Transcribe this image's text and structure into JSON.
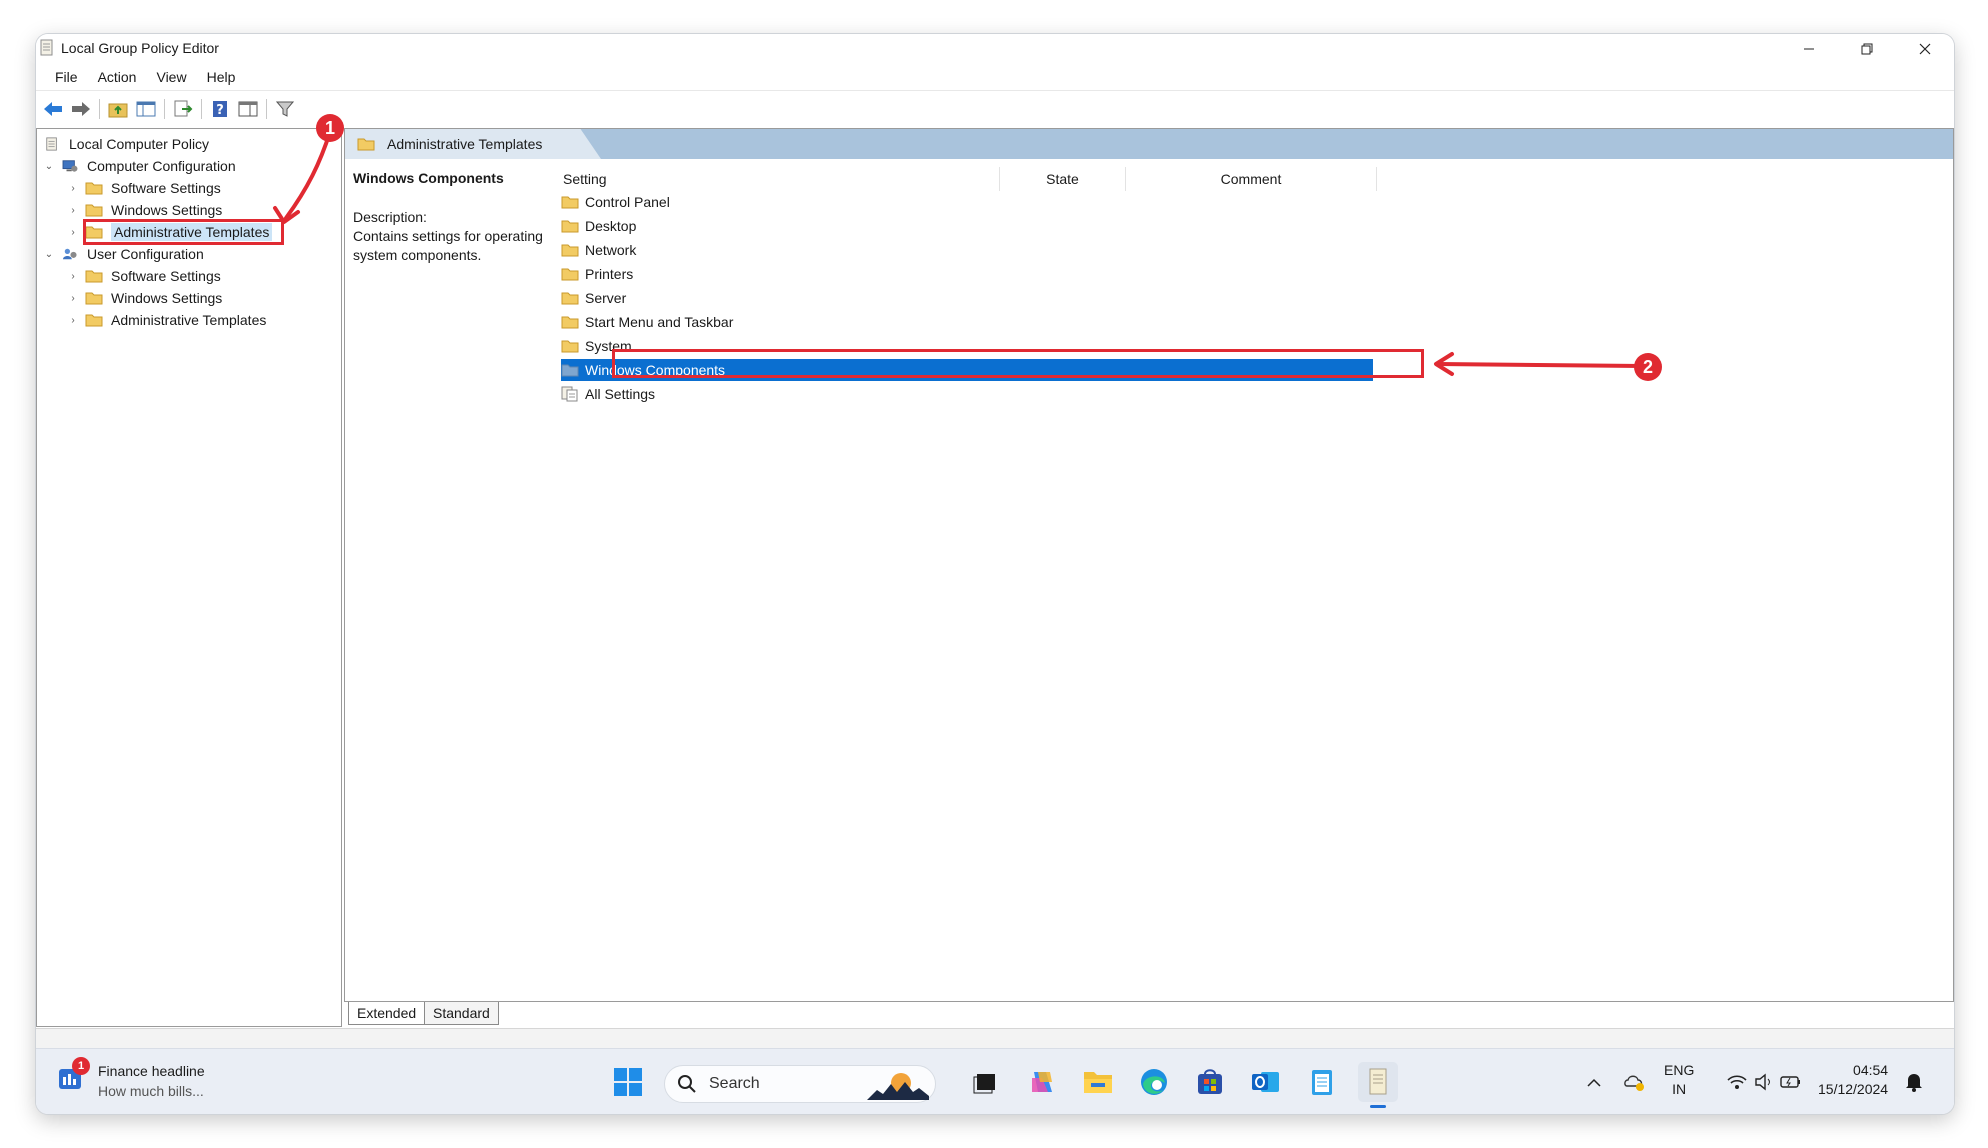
{
  "window": {
    "title": "Local Group Policy Editor"
  },
  "menu": [
    "File",
    "Action",
    "View",
    "Help"
  ],
  "tree": {
    "root": "Local Computer Policy",
    "computer_config": "Computer Configuration",
    "cc_children": [
      "Software Settings",
      "Windows Settings",
      "Administrative Templates"
    ],
    "user_config": "User Configuration",
    "uc_children": [
      "Software Settings",
      "Windows Settings",
      "Administrative Templates"
    ]
  },
  "header_tab": "Administrative Templates",
  "description": {
    "title": "Windows Components",
    "label": "Description:",
    "text": "Contains settings for operating system components."
  },
  "columns": {
    "setting": "Setting",
    "state": "State",
    "comment": "Comment"
  },
  "items": [
    "Control Panel",
    "Desktop",
    "Network",
    "Printers",
    "Server",
    "Start Menu and Taskbar",
    "System",
    "Windows Components",
    "All Settings"
  ],
  "selected_item": "Windows Components",
  "view_tabs": [
    "Extended",
    "Standard"
  ],
  "annotations": {
    "badge1": "1",
    "badge2": "2"
  },
  "taskbar": {
    "widget_badge": "1",
    "widget_title": "Finance headline",
    "widget_sub": "How much bills...",
    "search_label": "Search",
    "lang_line1": "ENG",
    "lang_line2": "IN",
    "time": "04:54",
    "date": "15/12/2024"
  },
  "colors": {
    "accent": "#0b6fd0",
    "annotation": "#e02a32",
    "header_band": "#a9c3dc"
  }
}
